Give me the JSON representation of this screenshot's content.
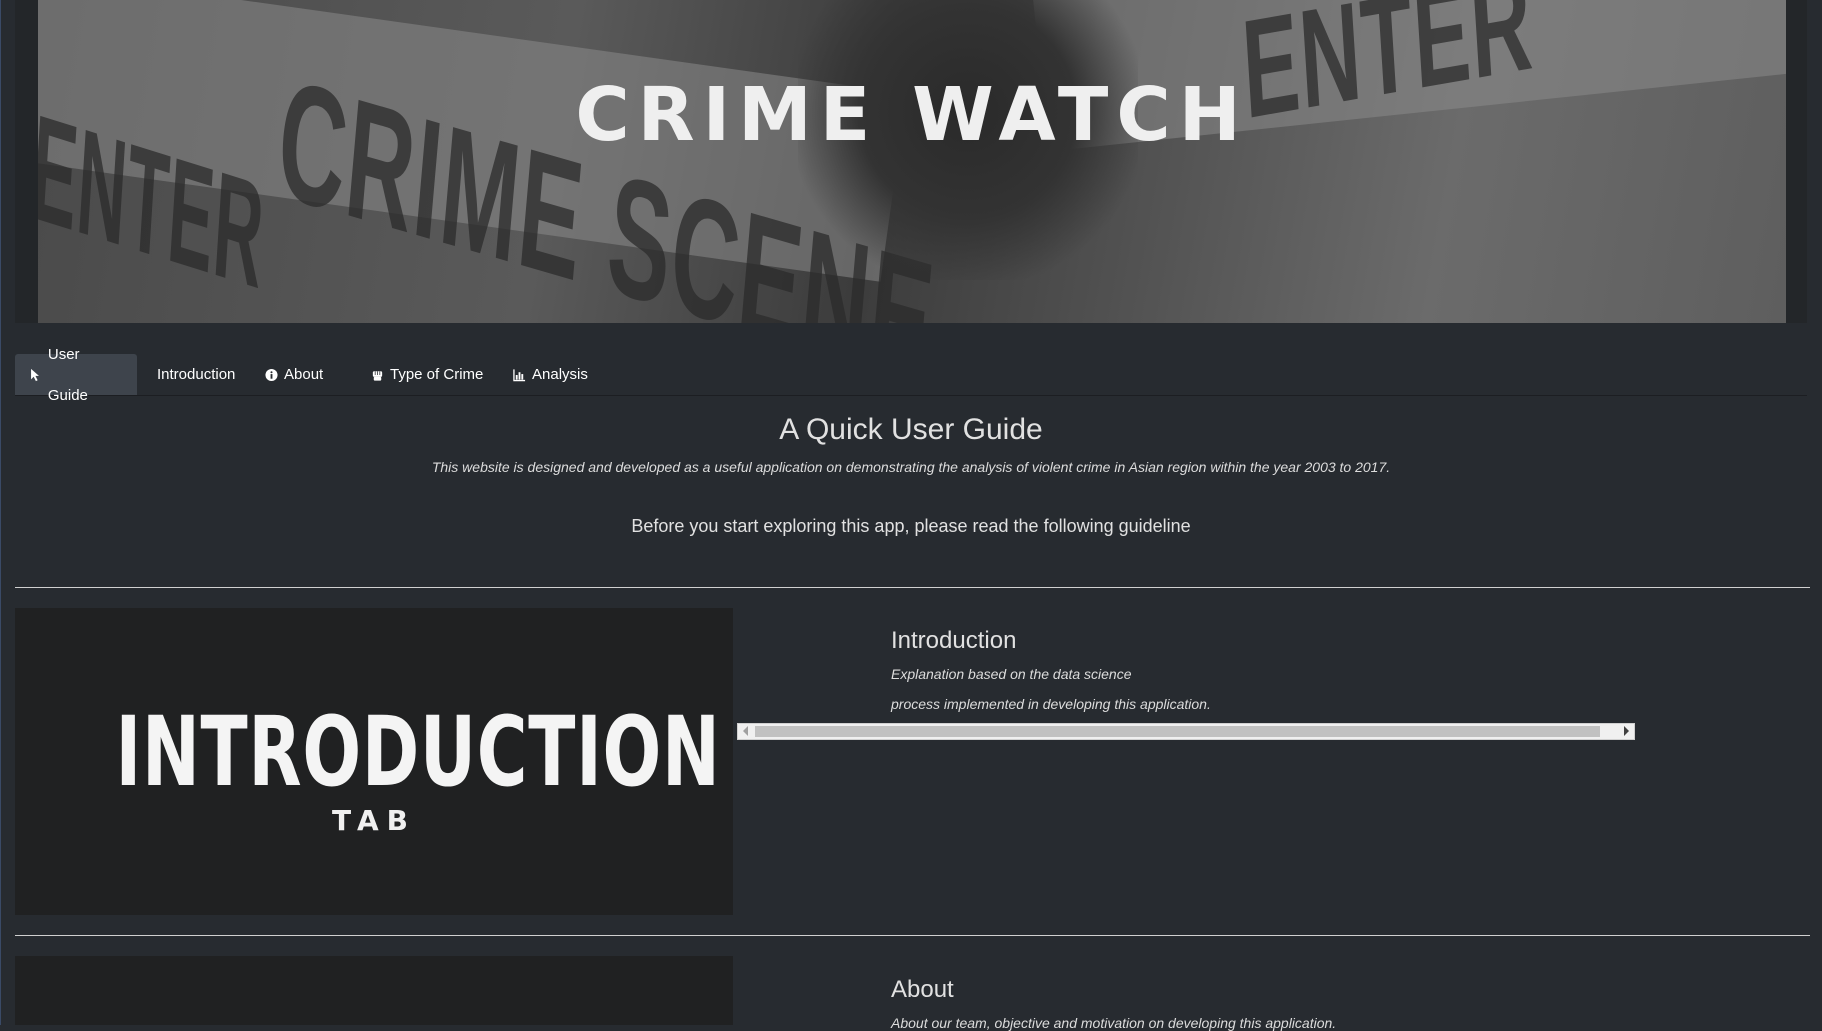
{
  "banner": {
    "title": "CRIME WATCH",
    "tape_words": [
      "ENTER",
      "CRIME SCENE",
      "ENTER"
    ]
  },
  "tabs": [
    {
      "label": "User Guide",
      "icon": "pointer-icon",
      "active": true
    },
    {
      "label": "Introduction",
      "icon": "",
      "active": false
    },
    {
      "label": "About",
      "icon": "info-icon",
      "active": false
    },
    {
      "label": "Type of Crime",
      "icon": "fist-icon",
      "active": false
    },
    {
      "label": "Analysis",
      "icon": "bar-chart-icon",
      "active": false
    }
  ],
  "guide": {
    "title": "A Quick User Guide",
    "subtitle": "This website is designed and developed as a useful application on demonstrating the analysis of violent crime in Asian region within the year 2003 to 2017.",
    "lead": "Before you start exploring this app, please read the following guideline"
  },
  "sections": [
    {
      "image_main": "INTRODUCTION",
      "image_sub": "TAB",
      "title": "Introduction",
      "desc_line1": "Explanation based on the data science",
      "desc_line2": "process implemented in developing this application."
    },
    {
      "title": "About",
      "desc_line1": "About our team, objective and motivation on developing this application."
    }
  ],
  "colors": {
    "background": "#272b30",
    "active_tab": "#3e444c",
    "text": "#e1e1e1"
  }
}
